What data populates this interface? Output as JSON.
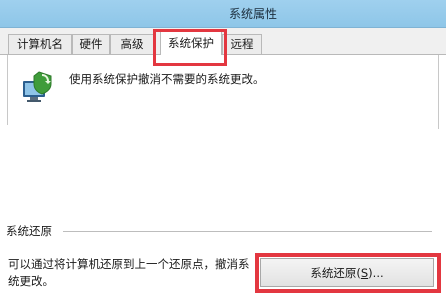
{
  "window": {
    "title": "系统属性"
  },
  "tabs": [
    {
      "label": "计算机名"
    },
    {
      "label": "硬件"
    },
    {
      "label": "高级"
    },
    {
      "label": "系统保护",
      "active": true
    },
    {
      "label": "远程"
    }
  ],
  "protection": {
    "icon": "system-protection-icon",
    "description": "使用系统保护撤消不需要的系统更改。"
  },
  "restore_group": {
    "label": "系统还原",
    "description": "可以通过将计算机还原到上一个还原点，撤消系统更改。",
    "button_text": "系统还原(",
    "button_key": "S",
    "button_suffix": ")..."
  },
  "colors": {
    "highlight": "#e33740",
    "titlebar": "#9fd0ee"
  }
}
